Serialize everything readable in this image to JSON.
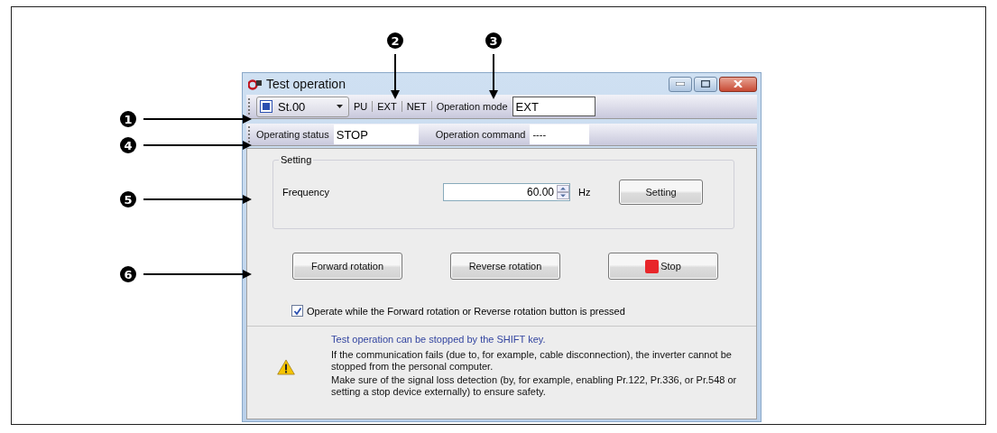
{
  "callouts": [
    {
      "number": "1",
      "kind": "right"
    },
    {
      "number": "2",
      "kind": "down"
    },
    {
      "number": "3",
      "kind": "down"
    },
    {
      "number": "4",
      "kind": "right"
    },
    {
      "number": "5",
      "kind": "right"
    },
    {
      "number": "6",
      "kind": "right"
    }
  ],
  "window": {
    "title": "Test operation"
  },
  "toolbar": {
    "station": "St.00",
    "modes": [
      "PU",
      "EXT",
      "NET"
    ],
    "mode_label": "Operation mode",
    "mode_value": "EXT"
  },
  "status_bar": {
    "status_label": "Operating status",
    "status_value": "STOP",
    "command_label": "Operation command",
    "command_value": "----"
  },
  "setting_group": {
    "title": "Setting",
    "label": "Frequency",
    "value": "60.00",
    "unit": "Hz",
    "button": "Setting"
  },
  "buttons": [
    {
      "label": "Forward rotation",
      "kind": "plain"
    },
    {
      "label": "Reverse rotation",
      "kind": "plain"
    },
    {
      "label": "Stop",
      "kind": "stop"
    }
  ],
  "checkbox": {
    "label": "Operate while the Forward rotation or Reverse rotation button is pressed",
    "checked": true
  },
  "notice": {
    "headline": "Test operation can be stopped by the SHIFT key.",
    "lines": [
      "If the communication fails (due to, for example, cable disconnection), the inverter cannot be stopped from the personal computer.",
      "Make sure of the signal loss detection (by, for example, enabling Pr.122, Pr.336, or Pr.548 or setting a stop device externally) to ensure safety."
    ]
  }
}
